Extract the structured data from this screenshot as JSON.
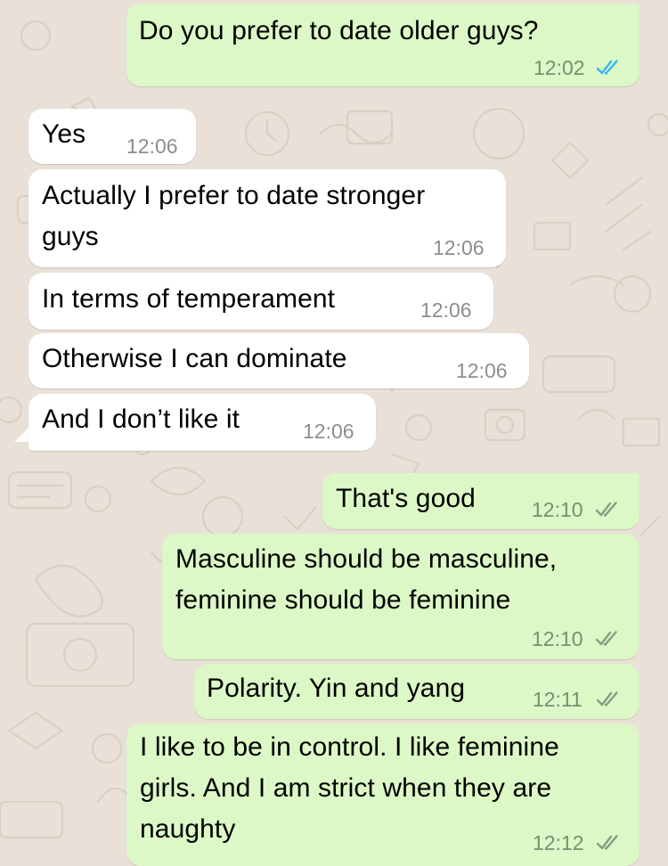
{
  "colors": {
    "wallpaper": "#e9e1d8",
    "incoming_bubble": "#ffffff",
    "outgoing_bubble": "#dcf8c6",
    "read_ticks": "#34b7f1",
    "delivered_ticks": "#8a9a80"
  },
  "messages": [
    {
      "direction": "outgoing",
      "text": "Do you prefer to date older guys?",
      "time": "12:02",
      "status": "read",
      "status_icon": "double-check-icon"
    },
    {
      "direction": "incoming",
      "text": "Yes",
      "time": "12:06"
    },
    {
      "direction": "incoming",
      "text": "Actually I prefer to date stronger\nguys",
      "time": "12:06"
    },
    {
      "direction": "incoming",
      "text": "In terms of temperament",
      "time": "12:06"
    },
    {
      "direction": "incoming",
      "text": "Otherwise I can dominate",
      "time": "12:06"
    },
    {
      "direction": "incoming",
      "text": "And I don’t like it",
      "time": "12:06"
    },
    {
      "direction": "outgoing",
      "text": "That's good",
      "time": "12:10",
      "status": "delivered",
      "status_icon": "double-check-icon"
    },
    {
      "direction": "outgoing",
      "text": "Masculine should be masculine,\nfeminine should be feminine",
      "time": "12:10",
      "status": "delivered",
      "status_icon": "double-check-icon"
    },
    {
      "direction": "outgoing",
      "text": "Polarity. Yin and yang",
      "time": "12:11",
      "status": "delivered",
      "status_icon": "double-check-icon"
    },
    {
      "direction": "outgoing",
      "text": "I like to be in control. I like feminine\ngirls. And I am strict when they are\nnaughty",
      "time": "12:12",
      "status": "delivered",
      "status_icon": "double-check-icon"
    }
  ]
}
